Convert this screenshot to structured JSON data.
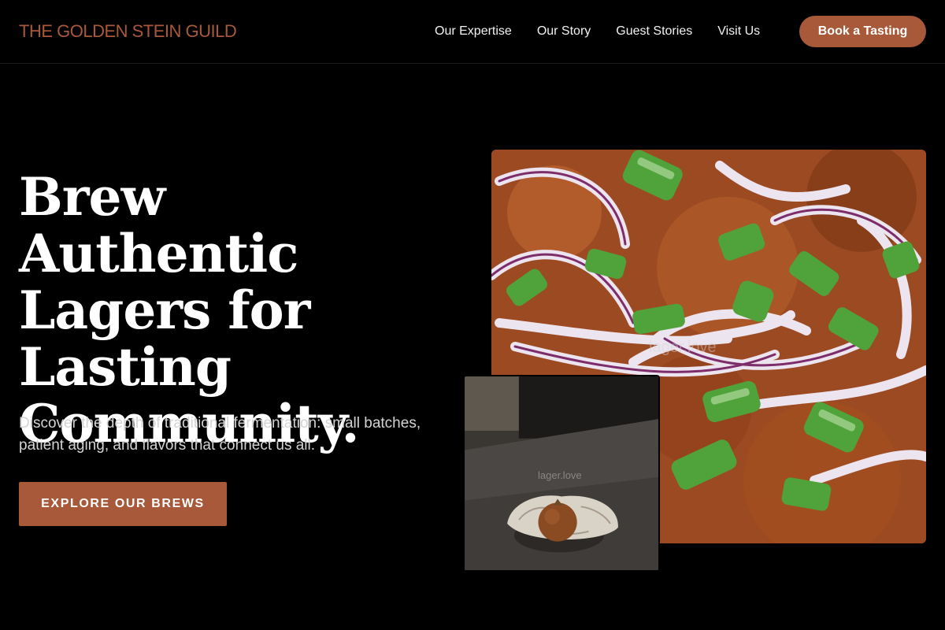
{
  "header": {
    "brand": "THE GOLDEN STEIN GUILD",
    "nav": [
      "Our Expertise",
      "Our Story",
      "Guest Stories",
      "Visit Us"
    ],
    "cta": "Book a Tasting"
  },
  "hero": {
    "headline": "Brew Authentic Lagers for Lasting Community.",
    "subtext": "Discover the depth of traditional fermentation: small batches, patient aging, and flavors that connect us all.",
    "cta": "EXPLORE OUR BREWS"
  },
  "images": {
    "large_watermark": "lager.love",
    "small_watermark": "lager.love"
  },
  "colors": {
    "accent": "#a8593a",
    "background": "#000000"
  }
}
